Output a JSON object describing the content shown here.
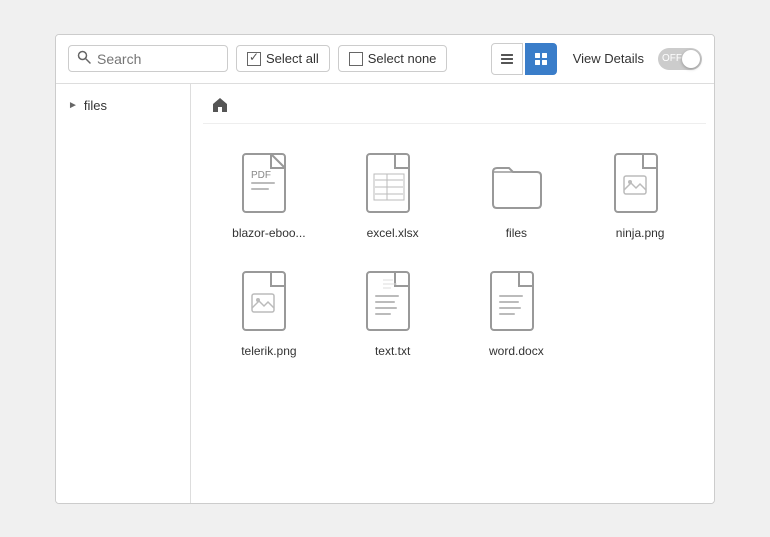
{
  "toolbar": {
    "search_placeholder": "Search",
    "select_all_label": "Select all",
    "select_none_label": "Select none",
    "view_details_label": "View Details",
    "toggle_state": "OFF",
    "list_view_icon": "list-icon",
    "grid_view_icon": "grid-icon"
  },
  "sidebar": {
    "items": [
      {
        "label": "files",
        "icon": "chevron-right-icon"
      }
    ]
  },
  "breadcrumb": {
    "home_icon": "home-icon"
  },
  "files": [
    {
      "name": "blazor-eboo...",
      "type": "pdf"
    },
    {
      "name": "excel.xlsx",
      "type": "excel"
    },
    {
      "name": "files",
      "type": "folder"
    },
    {
      "name": "ninja.png",
      "type": "image"
    },
    {
      "name": "telerik.png",
      "type": "image"
    },
    {
      "name": "text.txt",
      "type": "text"
    },
    {
      "name": "word.docx",
      "type": "word"
    }
  ]
}
